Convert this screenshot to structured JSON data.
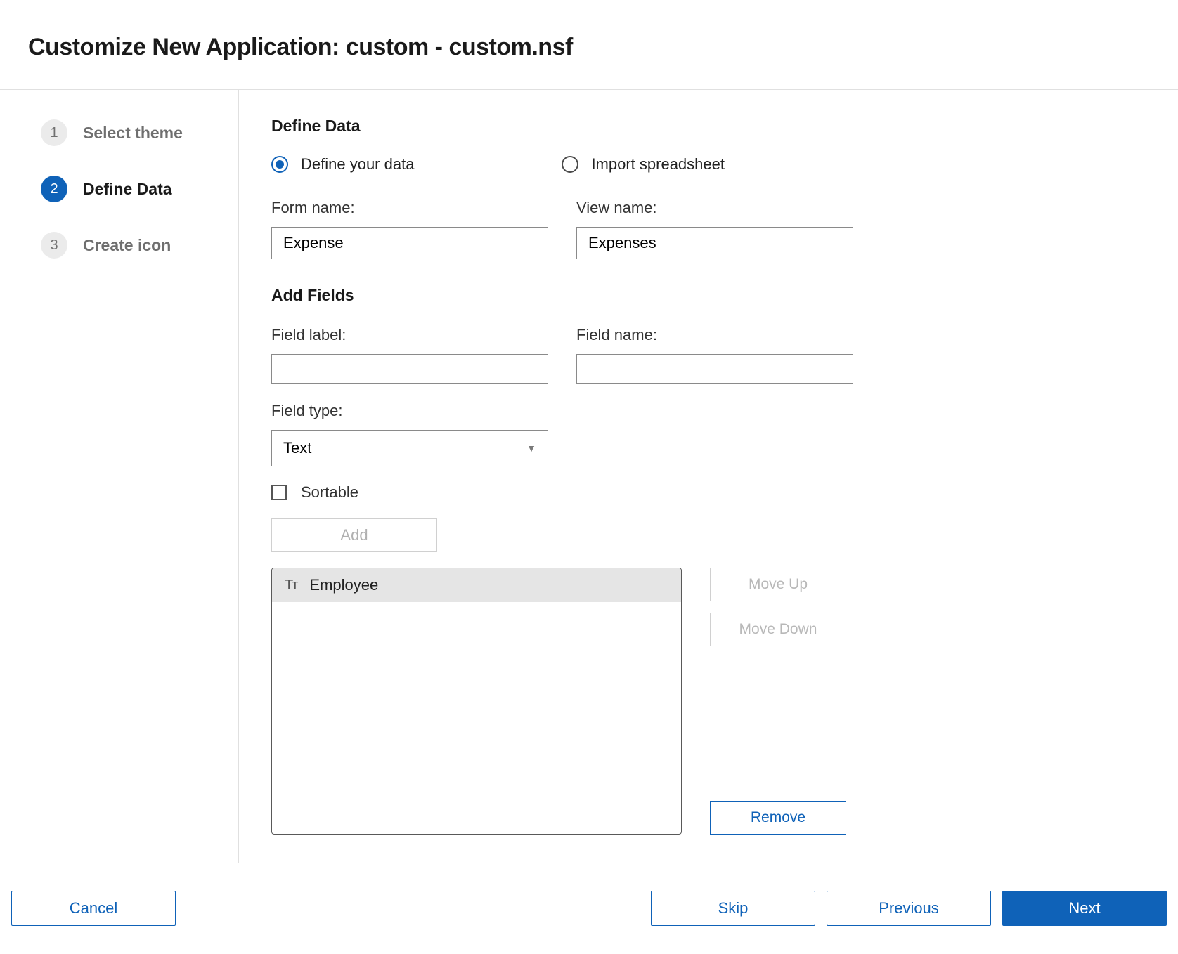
{
  "header": {
    "title": "Customize New Application: custom - custom.nsf"
  },
  "sidebar": {
    "steps": [
      {
        "num": "1",
        "label": "Select theme"
      },
      {
        "num": "2",
        "label": "Define Data"
      },
      {
        "num": "3",
        "label": "Create icon"
      }
    ]
  },
  "main": {
    "section_title": "Define Data",
    "radio_define": "Define your data",
    "radio_import": "Import spreadsheet",
    "form_name_label": "Form name:",
    "form_name_value": "Expense",
    "view_name_label": "View name:",
    "view_name_value": "Expenses",
    "add_fields_title": "Add Fields",
    "field_label_label": "Field label:",
    "field_label_value": "",
    "field_name_label": "Field name:",
    "field_name_value": "",
    "field_type_label": "Field type:",
    "field_type_value": "Text",
    "sortable_label": "Sortable",
    "add_button": "Add",
    "field_items": [
      {
        "icon": "Tᴛ",
        "label": "Employee"
      }
    ],
    "move_up": "Move Up",
    "move_down": "Move Down",
    "remove": "Remove"
  },
  "footer": {
    "cancel": "Cancel",
    "skip": "Skip",
    "previous": "Previous",
    "next": "Next"
  }
}
